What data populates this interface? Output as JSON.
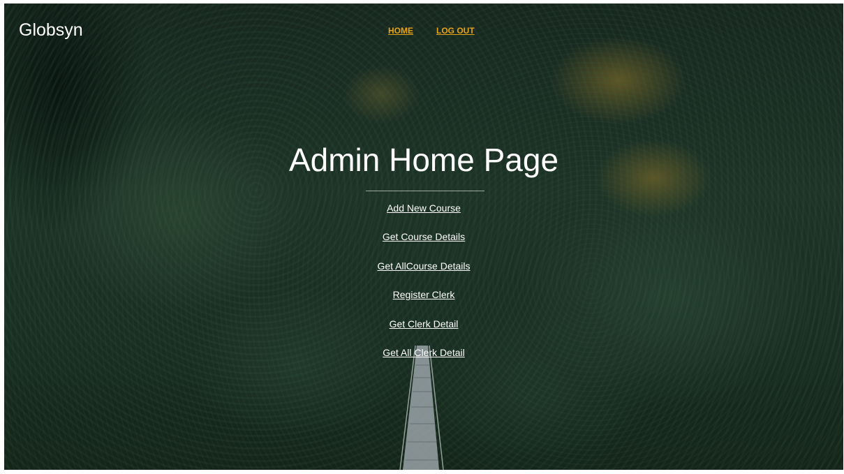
{
  "brand": {
    "name": "Globsyn"
  },
  "nav": {
    "home_label": "HOME",
    "logout_label": "LOG OUT",
    "link_color": "#e8a317"
  },
  "page": {
    "title": "Admin Home Page"
  },
  "menu": {
    "items": [
      {
        "label": "Add New Course"
      },
      {
        "label": "Get Course Details"
      },
      {
        "label": "Get AllCourse Details"
      },
      {
        "label": "Register Clerk"
      },
      {
        "label": "Get Clerk Detail"
      },
      {
        "label": "Get All Clerk Detail"
      }
    ]
  }
}
